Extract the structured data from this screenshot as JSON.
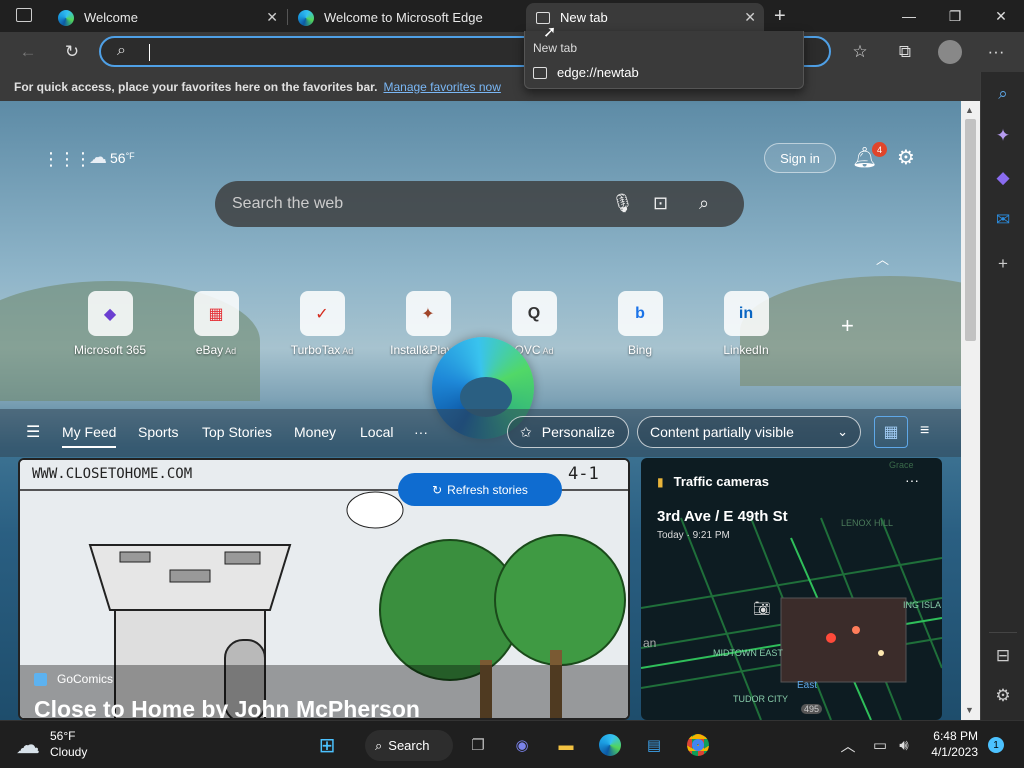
{
  "tabs": [
    {
      "title": "Welcome",
      "icon": "edge-icon"
    },
    {
      "title": "Welcome to Microsoft Edge",
      "icon": "edge-icon"
    },
    {
      "title": "New tab",
      "icon": "newtab-icon"
    }
  ],
  "address": {
    "value": ""
  },
  "tab_dropdown": {
    "header": "New tab",
    "url": "edge://newtab"
  },
  "favbar": {
    "message": "For quick access, place your favorites here on the favorites bar.",
    "link": "Manage favorites now"
  },
  "weather": {
    "temp": "56",
    "unit": "°F"
  },
  "header": {
    "sign_in": "Sign in",
    "notifications": "4"
  },
  "search": {
    "placeholder": "Search the web"
  },
  "quicklinks": [
    {
      "label": "Microsoft 365",
      "ad": "",
      "glyph": "◆",
      "color": "#6b3fd1"
    },
    {
      "label": "eBay",
      "ad": "Ad",
      "glyph": "▦",
      "color": "#e53238"
    },
    {
      "label": "TurboTax",
      "ad": "Ad",
      "glyph": "✓",
      "color": "#d52b1e"
    },
    {
      "label": "Install&Play",
      "ad": "Ad",
      "glyph": "✦",
      "color": "#a0452a"
    },
    {
      "label": "QVC",
      "ad": "Ad",
      "glyph": "Q",
      "color": "#333333"
    },
    {
      "label": "Bing",
      "ad": "",
      "glyph": "b",
      "color": "#1a73e8"
    },
    {
      "label": "LinkedIn",
      "ad": "",
      "glyph": "in",
      "color": "#0a66c2"
    }
  ],
  "feed": {
    "tabs": [
      "My Feed",
      "Sports",
      "Top Stories",
      "Money",
      "Local"
    ],
    "more": "···",
    "personalize": "Personalize",
    "visibility": "Content partially visible",
    "refresh": "Refresh stories"
  },
  "comic": {
    "site": "WWW.CLOSETOHOME.COM",
    "date": "4-1",
    "source": "GoComics",
    "title": "Close to Home by John McPherson"
  },
  "traffic": {
    "header": "Traffic cameras",
    "location": "3rd Ave / E 49th St",
    "time": "Today · 9:21 PM",
    "map_labels": [
      "LENOX HILL",
      "MIDTOWN EAST",
      "TUDOR CITY",
      "ING ISLA",
      "an",
      "East",
      "495",
      "Grace"
    ]
  },
  "taskbar": {
    "weather_temp": "56°F",
    "weather_desc": "Cloudy",
    "search": "Search",
    "time": "6:48 PM",
    "date": "4/1/2023",
    "notif": "1"
  }
}
